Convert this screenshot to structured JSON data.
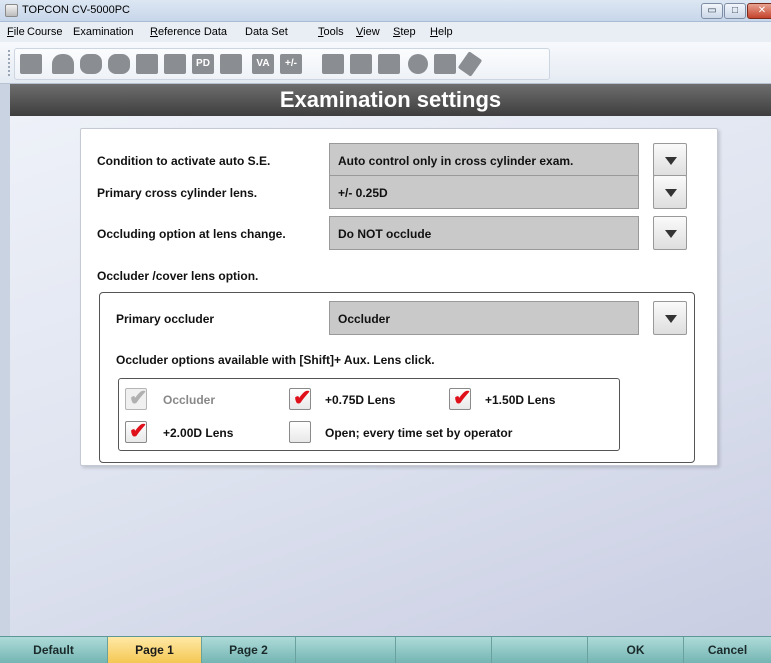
{
  "window": {
    "title": "TOPCON CV-5000PC",
    "controls": {
      "minimize": "▭",
      "maximize": "□",
      "close": "✕"
    }
  },
  "menu": [
    {
      "u": "F",
      "rest": "ile"
    },
    {
      "u": "",
      "rest": "Course"
    },
    {
      "u": "",
      "rest": "Examination"
    },
    {
      "u": "R",
      "rest": "eference Data"
    },
    {
      "u": "",
      "rest": "Data Set"
    },
    {
      "u": "T",
      "rest": "ools"
    },
    {
      "u": "V",
      "rest": "iew"
    },
    {
      "u": "S",
      "rest": "tep"
    },
    {
      "u": "H",
      "rest": "elp"
    }
  ],
  "toolbar": {
    "labels": {
      "pd": "PD",
      "va": "VA",
      "pm": "+/-"
    },
    "icons": [
      "patient-icon",
      "person-icon",
      "lens-icon",
      "lens2-icon",
      "chart-icon",
      "card-icon",
      "pd-icon",
      "square-icon",
      "va-icon",
      "pm-icon",
      "display-icon",
      "monitor-icon",
      "book-icon",
      "circle-icon",
      "printer-icon",
      "wrench-icon"
    ]
  },
  "header": {
    "title": "Examination settings"
  },
  "settings": {
    "auto_se": {
      "label": "Condition to activate auto S.E.",
      "value": "Auto control only in cross cylinder exam."
    },
    "cross_cyl": {
      "label": "Primary cross cylinder lens.",
      "value": "+/- 0.25D"
    },
    "occluding": {
      "label": "Occluding option at lens change.",
      "value": "Do NOT occlude"
    },
    "occluder_section": {
      "label": "Occluder /cover lens option."
    },
    "primary_occluder": {
      "label": "Primary occluder",
      "value": "Occluder"
    },
    "aux_options": {
      "label": "Occluder options available with [Shift]+ Aux. Lens click.",
      "check_glyph": "✔",
      "items": [
        {
          "label": "Occluder",
          "checked": true,
          "disabled": true
        },
        {
          "label": "+0.75D Lens",
          "checked": true,
          "disabled": false
        },
        {
          "label": "+1.50D Lens",
          "checked": true,
          "disabled": false
        },
        {
          "label": "+2.00D Lens",
          "checked": true,
          "disabled": false
        },
        {
          "label": "Open; every time set by operator",
          "checked": false,
          "disabled": false
        }
      ]
    }
  },
  "bottom_buttons": {
    "default": "Default",
    "page1": "Page 1",
    "page2": "Page 2",
    "ok": "OK",
    "cancel": "Cancel"
  },
  "colors": {
    "check": "#e0101a",
    "active_tab": "#f4c650",
    "bottom_bar": "#8ec7c5"
  }
}
